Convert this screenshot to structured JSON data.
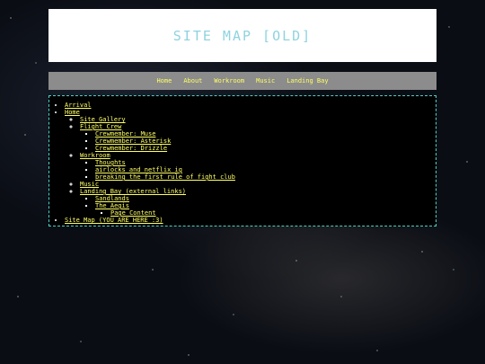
{
  "header": {
    "title": "SITE MAP [OLD]"
  },
  "nav": {
    "items": [
      "Home",
      "About",
      "Workroom",
      "Music",
      "Landing Bay"
    ]
  },
  "sitemap": {
    "arrival": "Arrival",
    "home": "Home",
    "site_gallery": "Site Gallery",
    "flight_crew": "Flight Crew",
    "crew_muse": "Crewmember: Muse",
    "crew_asterisk": "Crewmember: Asterisk",
    "crew_drizzle": "Crewmember: Drizzle",
    "workroom": "Workroom",
    "thoughts": "Thoughts",
    "airlocks": "airlocks and netflix ig",
    "fight_club": "breaking the first rule of fight club",
    "music": "Music",
    "landing_bay": "Landing Bay (external links)",
    "sandlands": "Sandlands",
    "the_aegis": "The Aegis",
    "page_content": "Page Content",
    "site_map": "Site Map (YOU ARE HERE :3)"
  },
  "colors": {
    "link": "#ffff66",
    "title": "#8fd3e0",
    "nav_bg": "#8c8c8c",
    "box_border": "#4fd1c5"
  }
}
